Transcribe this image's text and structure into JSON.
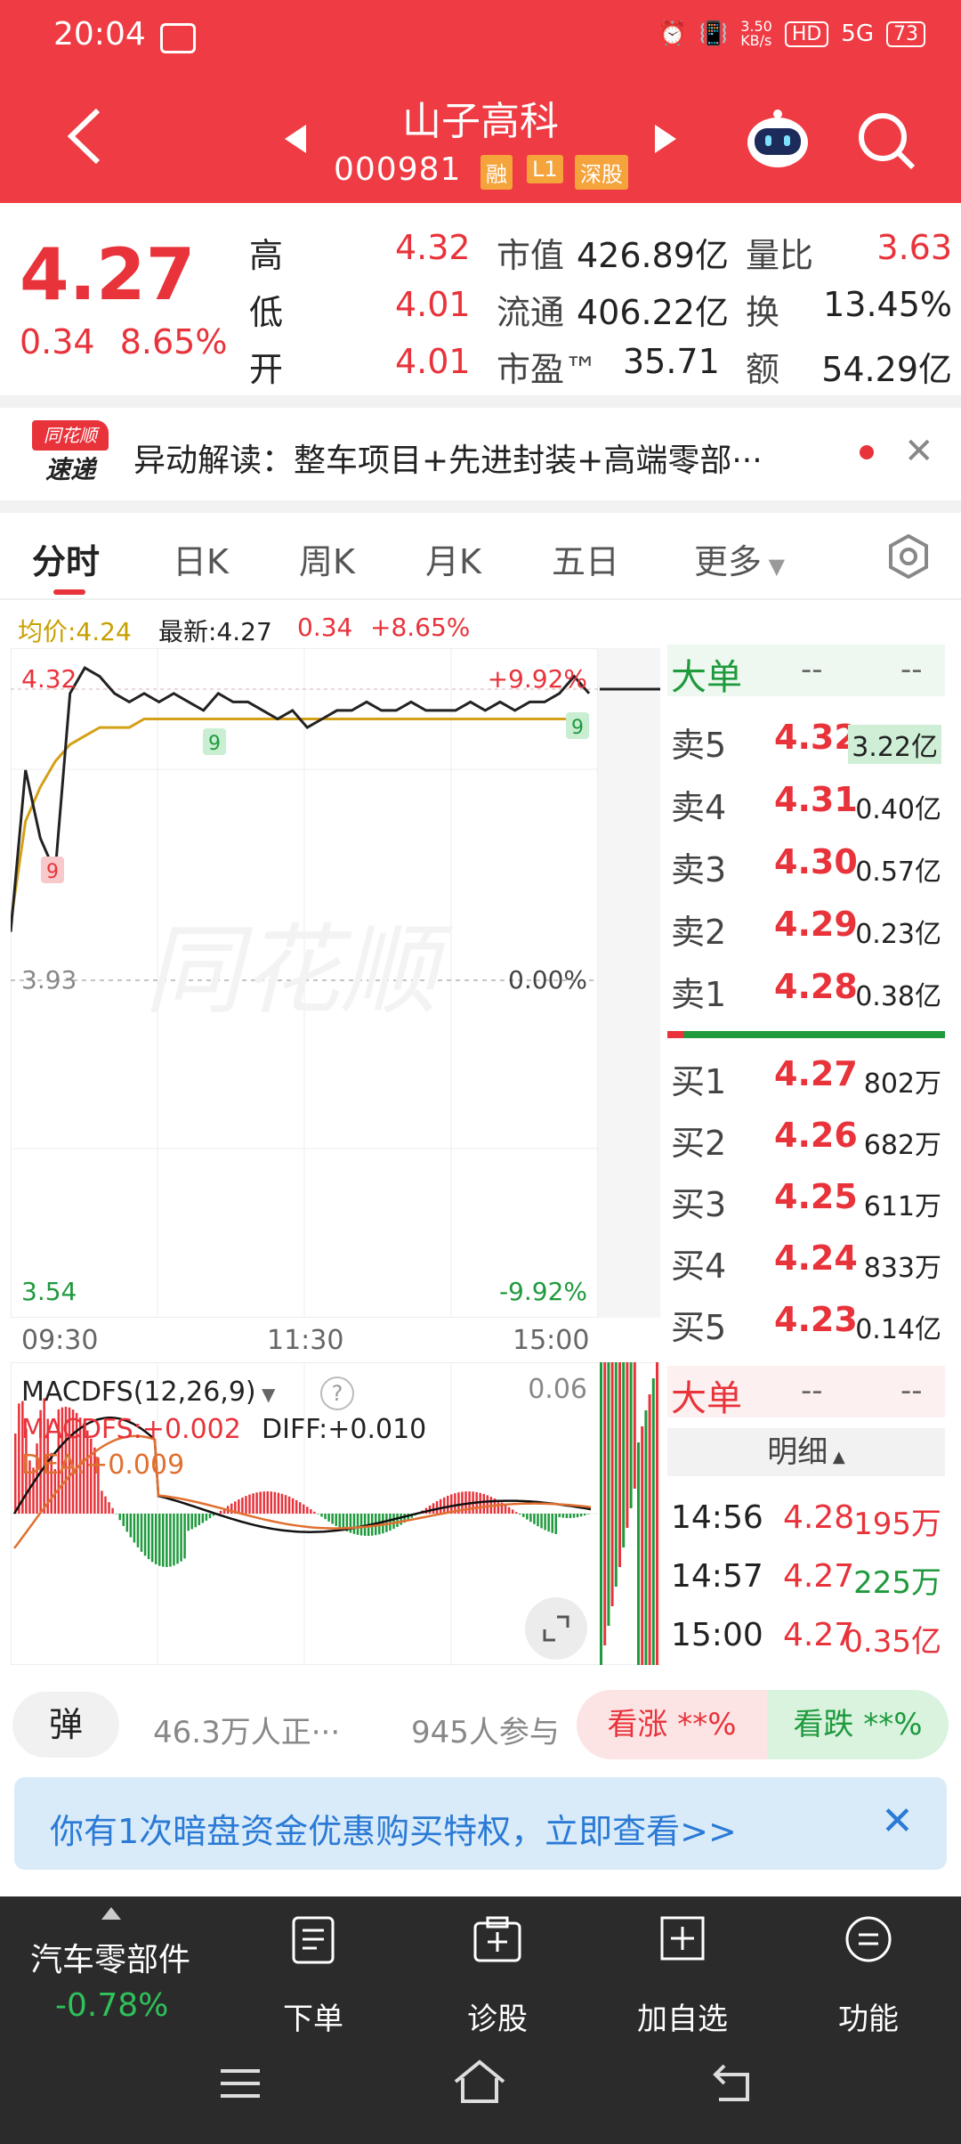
{
  "status_bar": {
    "time": "20:04",
    "net_speed": "3.50\nKB/s",
    "hd": "HD",
    "signal": "5G",
    "battery": "73"
  },
  "header": {
    "title": "山子高科",
    "code": "000981",
    "tags": [
      "融",
      "L1",
      "深股"
    ]
  },
  "quote": {
    "price": "4.27",
    "change": "0.34",
    "change_pct": "8.65%",
    "rows": [
      {
        "l1": "高",
        "v1": "4.32",
        "l2": "市值",
        "v2": "426.89亿",
        "l3": "量比",
        "v3": "3.63"
      },
      {
        "l1": "低",
        "v1": "4.01",
        "l2": "流通",
        "v2": "406.22亿",
        "l3": "换",
        "v3": "13.45%"
      },
      {
        "l1": "开",
        "v1": "4.01",
        "l2": "市盈™",
        "v2": "35.71",
        "l3": "额",
        "v3": "54.29亿"
      }
    ]
  },
  "news": {
    "logo_top": "同花顺",
    "logo_bottom": "速递",
    "text": "异动解读：整车项目+先进封装+高端零部···"
  },
  "tabs": [
    "分时",
    "日K",
    "周K",
    "月K",
    "五日",
    "更多"
  ],
  "info_bar": {
    "avg": "均价:4.24",
    "latest": "最新:4.27",
    "chg": "0.34",
    "pct": "+8.65%"
  },
  "chart_data": {
    "type": "line",
    "title": "",
    "y_labels": {
      "top": "4.32",
      "mid": "3.93",
      "bottom": "3.54"
    },
    "pct_labels": {
      "top": "+9.92%",
      "mid": "0.00%",
      "bottom": "-9.92%"
    },
    "x_labels": [
      "09:30",
      "11:30",
      "15:00"
    ],
    "ylim": [
      3.54,
      4.32
    ],
    "watermark": "同花顺",
    "markers": [
      "9",
      "9",
      "9"
    ],
    "price_series": [
      3.99,
      4.18,
      4.1,
      4.06,
      4.27,
      4.3,
      4.29,
      4.27,
      4.26,
      4.27,
      4.26,
      4.27,
      4.26,
      4.25,
      4.27,
      4.26,
      4.26,
      4.25,
      4.24,
      4.25,
      4.23,
      4.24,
      4.25,
      4.25,
      4.26,
      4.25,
      4.25,
      4.26,
      4.25,
      4.25,
      4.25,
      4.26,
      4.25,
      4.26,
      4.25,
      4.26,
      4.26,
      4.27,
      4.29,
      4.27
    ],
    "avg_series": [
      4.0,
      4.12,
      4.16,
      4.19,
      4.21,
      4.22,
      4.23,
      4.23,
      4.23,
      4.24,
      4.24,
      4.24,
      4.24,
      4.24,
      4.24,
      4.24,
      4.24,
      4.24,
      4.24,
      4.24,
      4.24,
      4.24,
      4.24,
      4.24,
      4.24,
      4.24,
      4.24,
      4.24,
      4.24,
      4.24,
      4.24,
      4.24,
      4.24,
      4.24,
      4.24,
      4.24,
      4.24,
      4.24,
      4.24,
      4.24
    ]
  },
  "order_book": {
    "header": "大单",
    "dash": "--",
    "asks": [
      {
        "label": "卖5",
        "price": "4.32",
        "vol": "3.22亿"
      },
      {
        "label": "卖4",
        "price": "4.31",
        "vol": "0.40亿"
      },
      {
        "label": "卖3",
        "price": "4.30",
        "vol": "0.57亿"
      },
      {
        "label": "卖2",
        "price": "4.29",
        "vol": "0.23亿"
      },
      {
        "label": "卖1",
        "price": "4.28",
        "vol": "0.38亿"
      }
    ],
    "bids": [
      {
        "label": "买1",
        "price": "4.27",
        "vol": "802万"
      },
      {
        "label": "买2",
        "price": "4.26",
        "vol": "682万"
      },
      {
        "label": "买3",
        "price": "4.25",
        "vol": "611万"
      },
      {
        "label": "买4",
        "price": "4.24",
        "vol": "833万"
      },
      {
        "label": "买5",
        "price": "4.23",
        "vol": "0.14亿"
      }
    ]
  },
  "macd": {
    "name": "MACDFS(12,26,9)",
    "macdfs": "MACDFS:+0.002",
    "diff": "DIFF:+0.010",
    "dea": "DEA:+0.009",
    "top_value": "0.06"
  },
  "detail": {
    "header": "大单",
    "dash": "--",
    "title": "明细",
    "rows": [
      {
        "time": "14:56",
        "price": "4.28",
        "vol": "195万",
        "color": "#e8333b"
      },
      {
        "time": "14:57",
        "price": "4.27",
        "vol": "225万",
        "color": "#1f9a3d"
      },
      {
        "time": "15:00",
        "price": "4.27",
        "vol": "0.35亿",
        "color": "#e8333b"
      }
    ]
  },
  "poll": {
    "danmu": "弹",
    "viewers": "46.3万人正···",
    "participants": "945人参与",
    "up": "看涨 **%",
    "down": "看跌 **%"
  },
  "promo": {
    "text": "你有1次暗盘资金优惠购买特权，立即查看>>"
  },
  "bottom": {
    "sector": "汽车零部件",
    "sector_chg": "-0.78%",
    "items": [
      "下单",
      "诊股",
      "加自选",
      "功能"
    ]
  },
  "colors": {
    "header_red": "#ef3b43",
    "up": "#e8333b",
    "down": "#1f9a3d",
    "promo_bg": "#d9ebf9"
  }
}
